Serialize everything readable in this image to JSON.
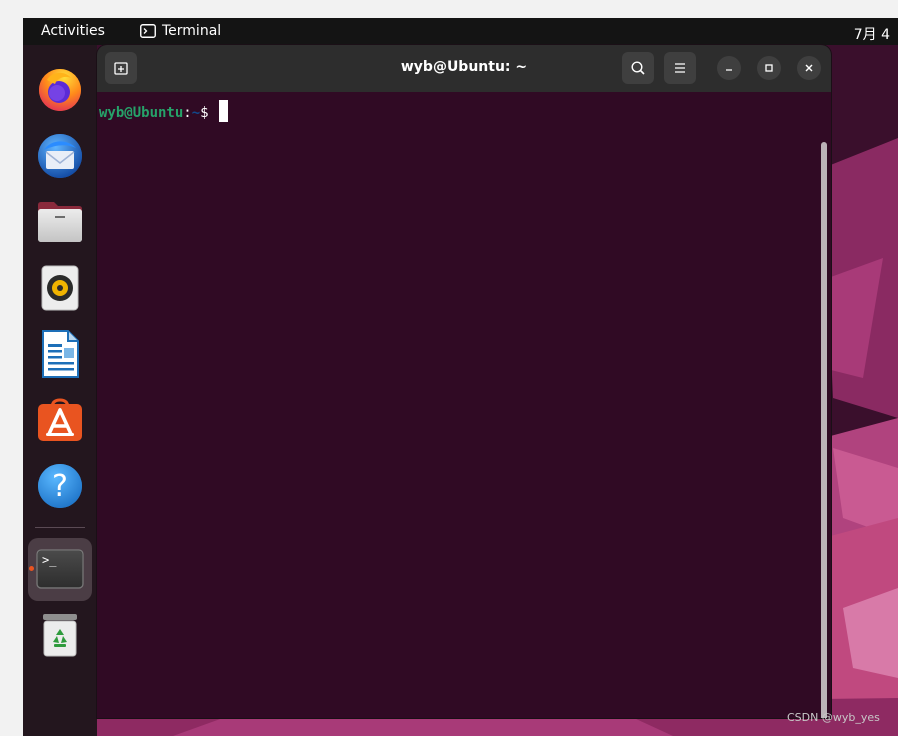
{
  "topbar": {
    "activities_label": "Activities",
    "app_name": "Terminal",
    "clock": "7月 4"
  },
  "dock": {
    "items": [
      {
        "name": "Firefox",
        "icon": "firefox-icon"
      },
      {
        "name": "Thunderbird",
        "icon": "thunderbird-icon"
      },
      {
        "name": "Files",
        "icon": "files-icon"
      },
      {
        "name": "Rhythmbox",
        "icon": "rhythmbox-icon"
      },
      {
        "name": "LibreOffice Writer",
        "icon": "writer-icon"
      },
      {
        "name": "Ubuntu Software",
        "icon": "software-store-icon"
      },
      {
        "name": "Help",
        "icon": "help-icon"
      },
      {
        "name": "Terminal",
        "icon": "terminal-icon",
        "running": true
      },
      {
        "name": "Trash",
        "icon": "trash-icon"
      }
    ],
    "help_glyph": "?"
  },
  "terminal": {
    "title": "wyb@Ubuntu: ~",
    "prompt_user": "wyb@Ubuntu",
    "prompt_colon": ":",
    "prompt_path": "~",
    "prompt_symbol": "$ ",
    "terminal_glyph": ">_"
  },
  "watermark": "CSDN @wyb_yes",
  "colors": {
    "terminal_bg": "#300a24",
    "accent": "#e95420",
    "prompt_user": "#26a269",
    "prompt_path": "#12488b"
  }
}
